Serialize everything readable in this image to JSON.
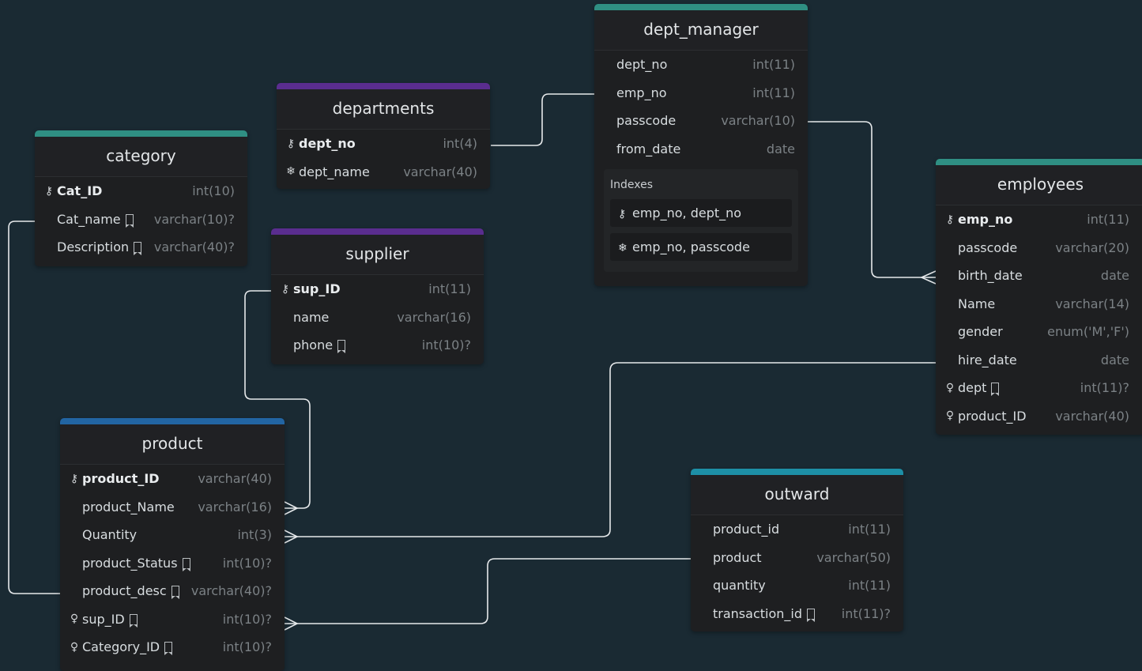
{
  "colors": {
    "background": "#1a2a33",
    "teal": "#2f8f83",
    "purple": "#5a2d8f",
    "blue": "#2265a3",
    "cyan": "#1d8fa6"
  },
  "icons": {
    "key": "key-icon",
    "unique": "snowflake-icon",
    "fk": "pin-icon",
    "note": "note-icon"
  },
  "tables": {
    "category": {
      "title": "category",
      "rows": [
        {
          "name": "Cat_ID",
          "type": "int(10)",
          "key": true
        },
        {
          "name": "Cat_name",
          "type": "varchar(10)?",
          "note": true
        },
        {
          "name": "Description",
          "type": "varchar(40)?",
          "note": true
        }
      ]
    },
    "departments": {
      "title": "departments",
      "rows": [
        {
          "name": "dept_no",
          "type": "int(4)",
          "key": true
        },
        {
          "name": "dept_name",
          "type": "varchar(40)",
          "unique": true
        }
      ]
    },
    "supplier": {
      "title": "supplier",
      "rows": [
        {
          "name": "sup_ID",
          "type": "int(11)",
          "key": true
        },
        {
          "name": "name",
          "type": "varchar(16)"
        },
        {
          "name": "phone",
          "type": "int(10)?",
          "note": true
        }
      ]
    },
    "dept_manager": {
      "title": "dept_manager",
      "rows": [
        {
          "name": "dept_no",
          "type": "int(11)"
        },
        {
          "name": "emp_no",
          "type": "int(11)"
        },
        {
          "name": "passcode",
          "type": "varchar(10)"
        },
        {
          "name": "from_date",
          "type": "date"
        }
      ],
      "indexes_label": "Indexes",
      "indexes": [
        {
          "text": "emp_no, dept_no",
          "kind": "key"
        },
        {
          "text": "emp_no, passcode",
          "kind": "unique"
        }
      ]
    },
    "employees": {
      "title": "employees",
      "rows": [
        {
          "name": "emp_no",
          "type": "int(11)",
          "key": true
        },
        {
          "name": "passcode",
          "type": "varchar(20)"
        },
        {
          "name": "birth_date",
          "type": "date"
        },
        {
          "name": "Name",
          "type": "varchar(14)"
        },
        {
          "name": "gender",
          "type": "enum('M','F')"
        },
        {
          "name": "hire_date",
          "type": "date"
        },
        {
          "name": "dept",
          "type": "int(11)?",
          "fk": true,
          "note": true
        },
        {
          "name": "product_ID",
          "type": "varchar(40)",
          "fk": true
        }
      ]
    },
    "product": {
      "title": "product",
      "rows": [
        {
          "name": "product_ID",
          "type": "varchar(40)",
          "key": true
        },
        {
          "name": "product_Name",
          "type": "varchar(16)"
        },
        {
          "name": "Quantity",
          "type": "int(3)"
        },
        {
          "name": "product_Status",
          "type": "int(10)?",
          "note": true
        },
        {
          "name": "product_desc",
          "type": "varchar(40)?",
          "note": true
        },
        {
          "name": "sup_ID",
          "type": "int(10)?",
          "fk": true,
          "note": true
        },
        {
          "name": "Category_ID",
          "type": "int(10)?",
          "fk": true,
          "note": true
        }
      ]
    },
    "outward": {
      "title": "outward",
      "rows": [
        {
          "name": "product_id",
          "type": "int(11)"
        },
        {
          "name": "product",
          "type": "varchar(50)"
        },
        {
          "name": "quantity",
          "type": "int(11)"
        },
        {
          "name": "transaction_id",
          "type": "int(11)?",
          "note": true
        }
      ]
    }
  }
}
